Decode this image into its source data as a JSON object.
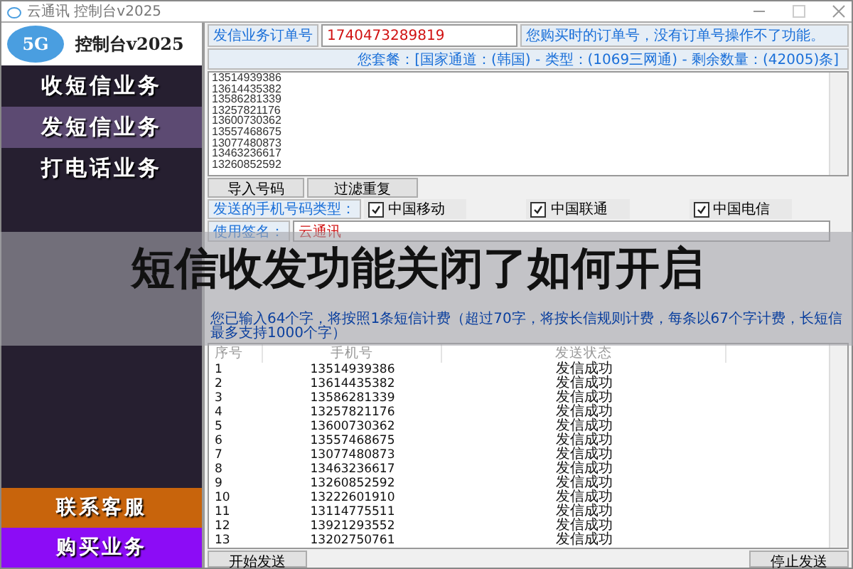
{
  "window": {
    "title": "云通讯 控制台v2025"
  },
  "logo": {
    "badge": "5G",
    "title": "控制台v2025"
  },
  "sidebar": {
    "items": [
      {
        "label": "收短信业务",
        "selected": false
      },
      {
        "label": "发短信业务",
        "selected": true
      },
      {
        "label": "打电话业务",
        "selected": false
      }
    ],
    "bottom_items": [
      {
        "label": "联系客服",
        "color": "#c8640c"
      },
      {
        "label": "购买业务",
        "color": "#8c0cf6"
      }
    ]
  },
  "order": {
    "label": "发信业务订单号",
    "value": "1740473289819",
    "hint": "您购买时的订单号，没有订单号操作不了功能。"
  },
  "package": "您套餐：[国家通道：(韩国) - 类型：(1069三网通) - 剩余数量：(42005)条]",
  "numbers": [
    "13514939386",
    "13614435382",
    "13586281339",
    "13257821176",
    "13600730362",
    "13557468675",
    "13077480873",
    "13463236617",
    "13260852592"
  ],
  "buttons": [
    "导入号码",
    "过滤重复"
  ],
  "carrier_type": {
    "label": "发送的手机号码类型：",
    "options": [
      {
        "label": "中国移动",
        "checked": true
      },
      {
        "label": "中国联通",
        "checked": true
      },
      {
        "label": "中国电信",
        "checked": true
      }
    ]
  },
  "signature": {
    "label": "使用签名：",
    "value": "云通讯"
  },
  "counter": "您已输入64个字，将按照1条短信计费（超过70字，将按长信规则计费，每条以67个字计费，长短信最多支持1000个字）",
  "table": {
    "columns": [
      "序号",
      "手机号",
      "发送状态"
    ],
    "rows": [
      [
        "1",
        "13514939386",
        "发信成功"
      ],
      [
        "2",
        "13614435382",
        "发信成功"
      ],
      [
        "3",
        "13586281339",
        "发信成功"
      ],
      [
        "4",
        "13257821176",
        "发信成功"
      ],
      [
        "5",
        "13600730362",
        "发信成功"
      ],
      [
        "6",
        "13557468675",
        "发信成功"
      ],
      [
        "7",
        "13077480873",
        "发信成功"
      ],
      [
        "8",
        "13463236617",
        "发信成功"
      ],
      [
        "9",
        "13260852592",
        "发信成功"
      ],
      [
        "10",
        "13222601910",
        "发信成功"
      ],
      [
        "11",
        "13114775511",
        "发信成功"
      ],
      [
        "12",
        "13921293552",
        "发信成功"
      ],
      [
        "13",
        "13202750761",
        "发信成功"
      ]
    ]
  },
  "actions": [
    "开始发送",
    "停止发送"
  ],
  "overlay_title": "短信收发功能关闭了如何开启"
}
